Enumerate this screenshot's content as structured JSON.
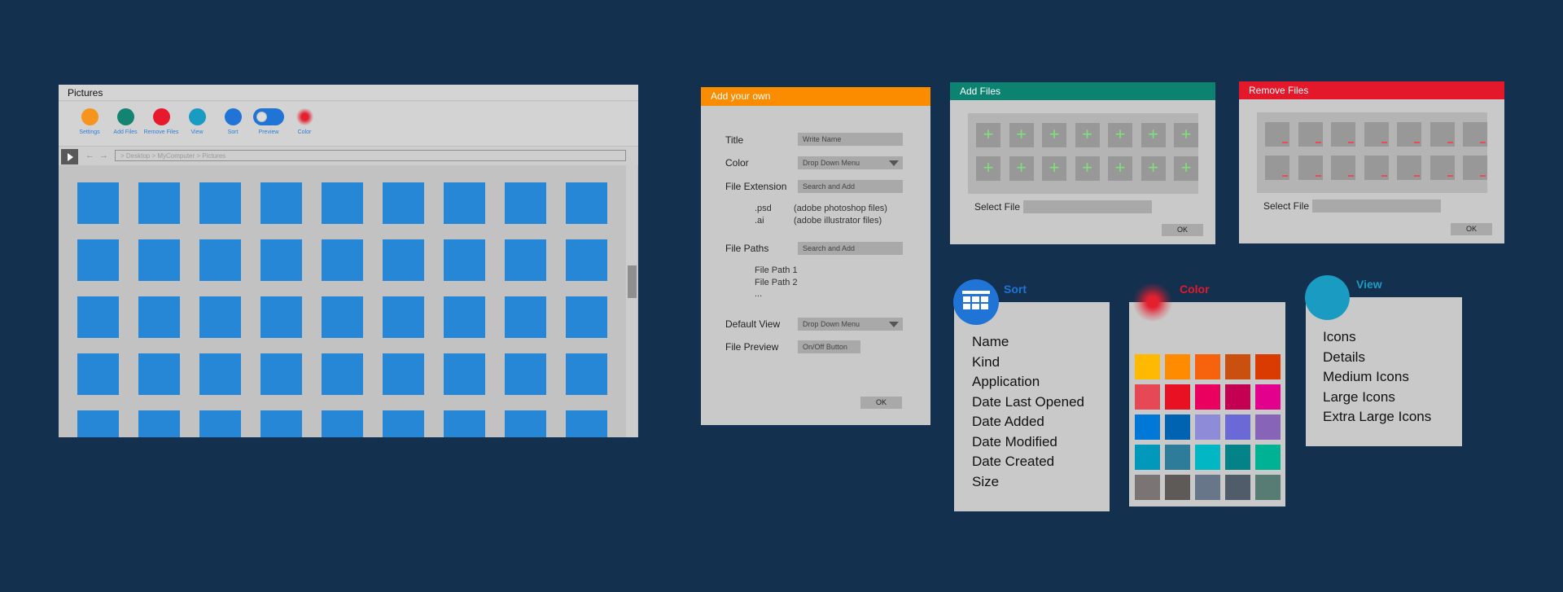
{
  "explorer": {
    "title": "Pictures",
    "ribbon": [
      {
        "label": "Settings",
        "color": "#f7941d"
      },
      {
        "label": "Add Files",
        "color": "#138471"
      },
      {
        "label": "Remove Files",
        "color": "#e8192c"
      },
      {
        "label": "View",
        "color": "#1a9cc2"
      },
      {
        "label": "Sort",
        "color": "#1f74d6"
      },
      {
        "label": "Preview",
        "color": "#1f74d6"
      },
      {
        "label": "Color",
        "color": "#e5202e"
      }
    ],
    "path": "> Desktop > MyComputer > Pictures",
    "tile_color": "#2787d7"
  },
  "add_own": {
    "header": "Add your own",
    "header_color": "#fb8c00",
    "title_label": "Title",
    "title_placeholder": "Write Name",
    "color_label": "Color",
    "color_value": "Drop Down Menu",
    "ext_label": "File Extension",
    "ext_value": "Search and Add",
    "ext_list": [
      {
        "ext": ".psd",
        "desc": "(adobe photoshop files)"
      },
      {
        "ext": ".ai",
        "desc": "(adobe illustrator files)"
      }
    ],
    "paths_label": "File Paths",
    "paths_value": "Search and Add",
    "paths_list": [
      "File Path 1",
      "File Path 2",
      "..."
    ],
    "view_label": "Default View",
    "view_value": "Drop Down Menu",
    "preview_label": "File Preview",
    "preview_value": "On/Off Button",
    "ok": "OK"
  },
  "add_files": {
    "header": "Add Files",
    "header_color": "#0b8370",
    "select_label": "Select File",
    "ok": "OK",
    "slot_glyph": "+"
  },
  "remove_files": {
    "header": "Remove Files",
    "header_color": "#e3182a",
    "select_label": "Select File",
    "ok": "OK"
  },
  "sort_menu": {
    "title": "Sort",
    "title_color": "#1f74d6",
    "items": [
      "Name",
      "Kind",
      "Application",
      "Date Last Opened",
      "Date Added",
      "Date Modified",
      "Date Created",
      "Size"
    ]
  },
  "color_menu": {
    "title": "Color",
    "title_color": "#e3182a",
    "swatches": [
      "#ffb900",
      "#ff8c00",
      "#f7630c",
      "#ca5010",
      "#da3b01",
      "#e74856",
      "#e81123",
      "#ea005e",
      "#c30052",
      "#e3008c",
      "#0078d7",
      "#0063b1",
      "#8e8cd8",
      "#6b69d6",
      "#8764b8",
      "#0099bc",
      "#2d7d9a",
      "#00b7c3",
      "#038387",
      "#00b294",
      "#7a7574",
      "#5d5a58",
      "#68768a",
      "#515c6b",
      "#567c73"
    ]
  },
  "view_menu": {
    "title": "View",
    "title_color": "#1a9cc2",
    "items": [
      "Icons",
      "Details",
      "Medium Icons",
      "Large Icons",
      "Extra Large Icons"
    ]
  }
}
